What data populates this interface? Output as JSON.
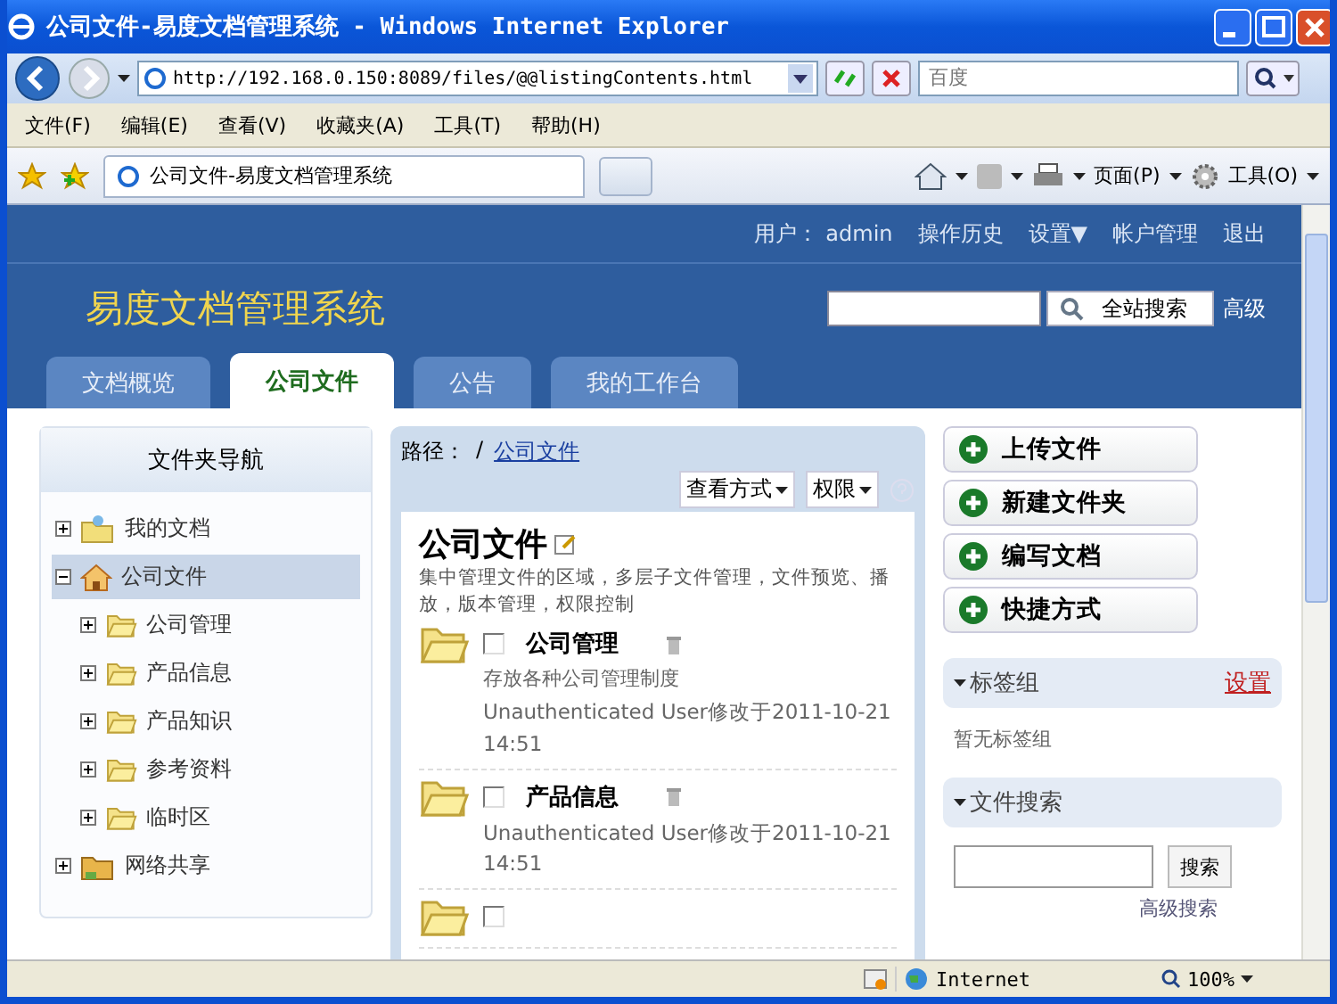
{
  "window": {
    "title": "公司文件-易度文档管理系统 - Windows Internet Explorer"
  },
  "address_bar": {
    "url": "http://192.168.0.150:8089/files/@@listingContents.html"
  },
  "search_box": {
    "placeholder": "百度"
  },
  "menu_bar": [
    "文件(F)",
    "编辑(E)",
    "查看(V)",
    "收藏夹(A)",
    "工具(T)",
    "帮助(H)"
  ],
  "browser_tab": {
    "title": "公司文件-易度文档管理系统",
    "selected": true
  },
  "command_bar": [
    "页面(P)",
    "工具(O)"
  ],
  "user_menu": {
    "label": "用户：",
    "username": "admin",
    "links": [
      "操作历史",
      "设置▼",
      "帐户管理",
      "退出"
    ]
  },
  "site_title": "易度文档管理系统",
  "site_search": {
    "button": "全站搜索",
    "advanced": "高级"
  },
  "nav_tabs": [
    {
      "label": "文档概览",
      "selected": false
    },
    {
      "label": "公司文件",
      "selected": true
    },
    {
      "label": "公告",
      "selected": false
    },
    {
      "label": "我的工作台",
      "selected": false
    }
  ],
  "folder_nav": {
    "title": "文件夹导航",
    "tree": [
      {
        "label": "我的文档",
        "kind": "personal",
        "expanded": false,
        "selected": false
      },
      {
        "label": "公司文件",
        "kind": "home",
        "expanded": true,
        "selected": true,
        "children": [
          {
            "label": "公司管理",
            "kind": "folder",
            "expanded": false,
            "selected": false
          },
          {
            "label": "产品信息",
            "kind": "folder",
            "expanded": false,
            "selected": false
          },
          {
            "label": "产品知识",
            "kind": "folder",
            "expanded": false,
            "selected": false
          },
          {
            "label": "参考资料",
            "kind": "folder",
            "expanded": false,
            "selected": false
          },
          {
            "label": "临时区",
            "kind": "folder",
            "expanded": false,
            "selected": false
          }
        ]
      },
      {
        "label": "网络共享",
        "kind": "network",
        "expanded": false,
        "selected": false
      }
    ]
  },
  "content": {
    "path_label": "路径：",
    "path_separator": "/",
    "path_link": "公司文件",
    "view_button": "查看方式",
    "permission_button": "权限",
    "title": "公司文件",
    "description": "集中管理文件的区域，多层子文件管理，文件预览、播放，版本管理，权限控制",
    "items": [
      {
        "name": "公司管理",
        "description": "存放各种公司管理制度",
        "modified": "Unauthenticated User修改于2011-10-21 14:51",
        "checked": false
      },
      {
        "name": "产品信息",
        "modified": "Unauthenticated User修改于2011-10-21 14:51",
        "checked": false
      }
    ],
    "clipped_item": {
      "checked": false
    }
  },
  "actions": [
    "上传文件",
    "新建文件夹",
    "编写文档",
    "快捷方式"
  ],
  "tag_group": {
    "title": "标签组",
    "settings_link": "设置",
    "empty_text": "暂无标签组"
  },
  "file_search": {
    "title": "文件搜索",
    "button": "搜索",
    "advanced": "高级搜索"
  },
  "status_bar": {
    "zone": "Internet",
    "zoom": "100%"
  }
}
